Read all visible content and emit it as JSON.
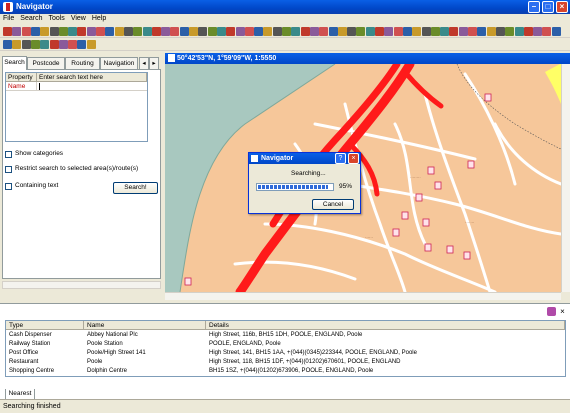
{
  "window": {
    "title": "Navigator"
  },
  "menu": [
    "File",
    "Search",
    "Tools",
    "View",
    "Help"
  ],
  "map": {
    "header": "50°42'53\"N, 1°59'09\"W, 1:5550"
  },
  "left_panel": {
    "tabs": [
      "Search",
      "Postcode",
      "Routing",
      "Navigation"
    ],
    "property_header": "Property",
    "search_header": "Enter search text here",
    "property_row": "Name",
    "search_value": "",
    "show_categories": "Show categories",
    "restrict_search": "Restrict search to selected area(s)/route(s)",
    "containing_text": "Containing text",
    "search_button": "Search!"
  },
  "dialog": {
    "title": "Navigator",
    "message": "Searching...",
    "percent_label": "95%",
    "progress": 0.95,
    "cancel_button": "Cancel"
  },
  "results": {
    "columns": [
      "Type",
      "Name",
      "Details"
    ],
    "rows": [
      [
        "Cash Dispenser",
        "Abbey National Plc",
        "High Street, 116b, BH15 1DH, POOLE, ENGLAND, Poole"
      ],
      [
        "Railway Station",
        "Poole Station",
        "POOLE, ENGLAND, Poole"
      ],
      [
        "Post Office",
        "Poole/High Street 141",
        "High Street, 141, BH15 1AA, +(044)(0345)223344, POOLE, ENGLAND, Poole"
      ],
      [
        "Restaurant",
        "Poole",
        "High Street, 118, BH15 1DF, +(044)(01202)670601, POOLE, ENGLAND"
      ],
      [
        "Shopping Centre",
        "Dolphin Centre",
        "BH15 1SZ, +(044)(01202)673906, POOLE, ENGLAND, Poole"
      ]
    ],
    "tab": "Nearest"
  },
  "status": "Searching finished",
  "colors": {
    "titlebar": "#0a5fe6",
    "road": "#ff1a1a",
    "land": "#f6c79a",
    "water": "#a8c8bf",
    "minor_road": "#ffffff",
    "major_road_alt": "#ffff66"
  }
}
